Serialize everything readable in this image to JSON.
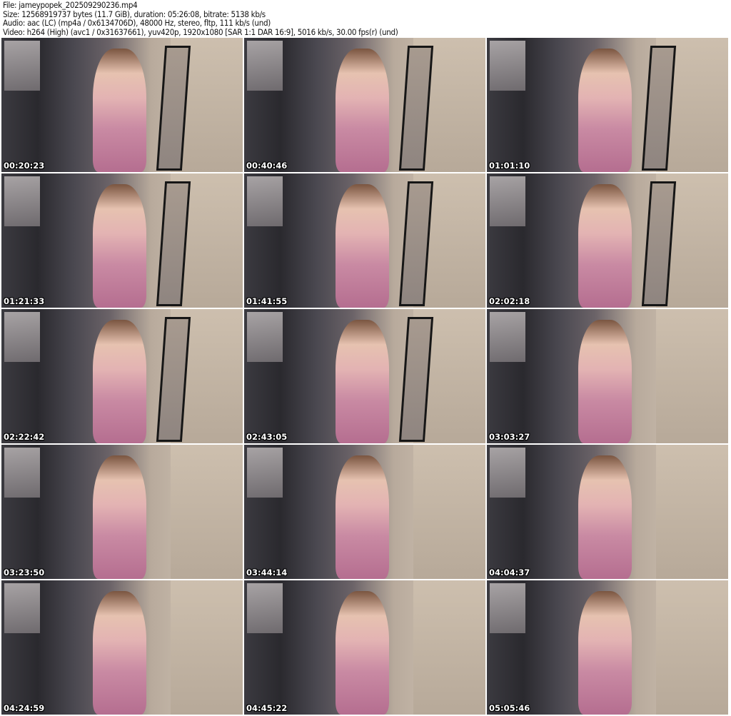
{
  "header": {
    "file": "File: jameypopek_202509290236.mp4",
    "size": "Size: 12568919737 bytes (11.7 GiB), duration: 05:26:08, bitrate: 5138 kb/s",
    "audio": "Audio: aac (LC) (mp4a / 0x6134706D), 48000 Hz, stereo, fltp, 111 kb/s (und)",
    "video": "Video: h264 (High) (avc1 / 0x31637661), yuv420p, 1920x1080 [SAR 1:1 DAR 16:9], 5016 kb/s, 30.00 fps(r) (und)"
  },
  "thumbnails": [
    {
      "timestamp": "00:20:23"
    },
    {
      "timestamp": "00:40:46"
    },
    {
      "timestamp": "01:01:10"
    },
    {
      "timestamp": "01:21:33"
    },
    {
      "timestamp": "01:41:55"
    },
    {
      "timestamp": "02:02:18"
    },
    {
      "timestamp": "02:22:42"
    },
    {
      "timestamp": "02:43:05"
    },
    {
      "timestamp": "03:03:27"
    },
    {
      "timestamp": "03:23:50"
    },
    {
      "timestamp": "03:44:14"
    },
    {
      "timestamp": "04:04:37"
    },
    {
      "timestamp": "04:24:59"
    },
    {
      "timestamp": "04:45:22"
    },
    {
      "timestamp": "05:05:46"
    }
  ]
}
